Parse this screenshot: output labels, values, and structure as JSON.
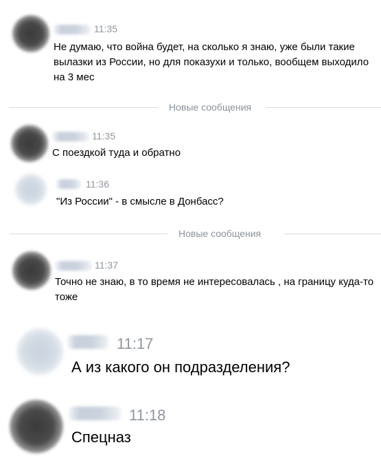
{
  "chat": {
    "messages": [
      {
        "time": "11:35",
        "text": "Не думаю, что война будет, на сколько я знаю, уже были такие вылазки из России, но для показухи и только, вообщем выходило на 3 мес"
      },
      {
        "time": "11:35",
        "text": "С поездкой туда и обратно"
      },
      {
        "time": "11:36",
        "text": "\"Из России\" - в смысле в Донбасс?"
      },
      {
        "time": "11:37",
        "text": "Точно не знаю, в то время не интересовалась , на границу куда-то тоже"
      },
      {
        "time": "11:17",
        "text": "А из какого он подразделения?"
      },
      {
        "time": "11:18",
        "text": "Спецназ"
      }
    ],
    "dividers": [
      {
        "label": "Новые сообщения"
      },
      {
        "label": "Новые сообщения"
      }
    ]
  }
}
